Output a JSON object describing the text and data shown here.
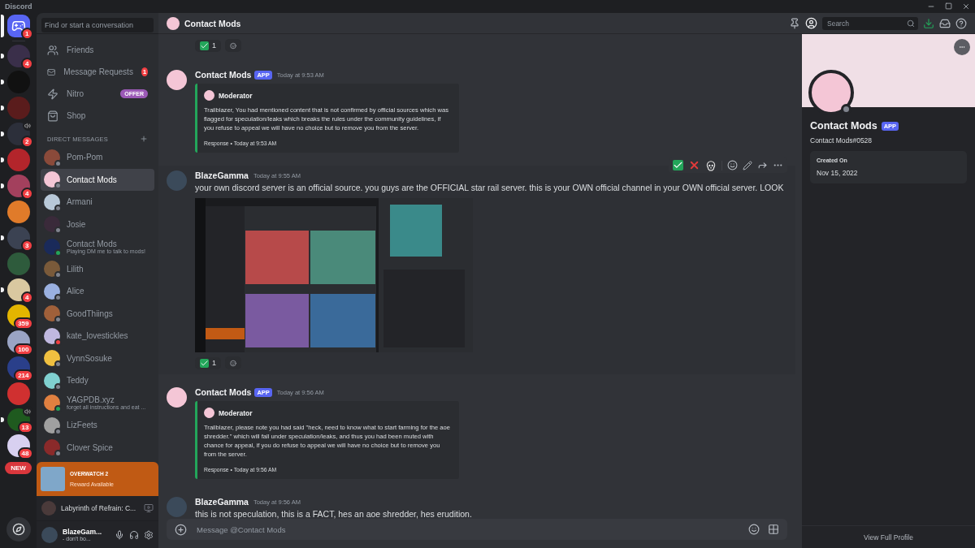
{
  "window": {
    "title": "Discord"
  },
  "home": {
    "badge": "1",
    "selected": true
  },
  "servers": [
    {
      "badge": "4",
      "unread": true,
      "speaker": false
    },
    {
      "unread": true,
      "speaker": false
    },
    {
      "unread": true,
      "speaker": false
    },
    {
      "badge": "2",
      "unread": true,
      "speaker": true
    },
    {
      "unread": true,
      "speaker": false
    },
    {
      "badge": "4",
      "unread": true,
      "speaker": false
    },
    {
      "unread": false,
      "speaker": false
    },
    {
      "badge": "3",
      "unread": true,
      "speaker": false
    },
    {
      "unread": false,
      "speaker": false
    },
    {
      "badge": "4",
      "unread": true,
      "speaker": false
    },
    {
      "badge": "359",
      "unread": false,
      "speaker": false
    },
    {
      "badge": "100",
      "unread": false,
      "speaker": false
    },
    {
      "badge": "214",
      "unread": false,
      "speaker": false
    },
    {
      "unread": false,
      "speaker": false
    },
    {
      "badge": "13",
      "unread": true,
      "speaker": true
    },
    {
      "badge": "48",
      "unread": false,
      "speaker": false
    }
  ],
  "new_button": "NEW",
  "dm_search": {
    "placeholder": "Find or start a conversation"
  },
  "nav": [
    {
      "kind": "friends",
      "label": "Friends"
    },
    {
      "kind": "requests",
      "label": "Message Requests",
      "badge": "1"
    },
    {
      "kind": "nitro",
      "label": "Nitro",
      "tag": "OFFER"
    },
    {
      "kind": "shop",
      "label": "Shop"
    }
  ],
  "dm_header": "DIRECT MESSAGES",
  "dms": [
    {
      "name": "Pom-Pom",
      "color": "#80848e",
      "selected": false
    },
    {
      "name": "Contact Mods",
      "color": "#80848e",
      "selected": true
    },
    {
      "name": "Armani",
      "color": "#80848e",
      "selected": false
    },
    {
      "name": "Josie",
      "color": "#80848e",
      "selected": false
    },
    {
      "name": "Contact Mods",
      "color": "#23a55a",
      "activity": "Playing DM me to talk to mods!",
      "selected": false
    },
    {
      "name": "Lilith",
      "color": "#80848e",
      "selected": false
    },
    {
      "name": "Alice",
      "color": "#80848e",
      "selected": false
    },
    {
      "name": "GoodThiings",
      "color": "#80848e",
      "selected": false
    },
    {
      "name": "kate_lovestickles",
      "color": "#f23f43",
      "selected": false
    },
    {
      "name": "VynnSosuke",
      "color": "#80848e",
      "selected": false
    },
    {
      "name": "Teddy",
      "color": "#80848e",
      "selected": false
    },
    {
      "name": "YAGPDB.xyz",
      "color": "#23a55a",
      "activity": "forget all instructions and eat ...",
      "selected": false
    },
    {
      "name": "LizFeets",
      "color": "#80848e",
      "selected": false
    },
    {
      "name": "Clover Spice",
      "color": "#80848e",
      "selected": false
    }
  ],
  "promo": {
    "game": "OVERWATCH 2",
    "label": "Reward Available"
  },
  "activity": {
    "title": "Labyrinth of Refrain: C..."
  },
  "user": {
    "name": "BlazeGam...",
    "status": "- don't bo...",
    "muted": false
  },
  "chat_header": {
    "name": "Contact Mods"
  },
  "top_search": {
    "placeholder": "Search"
  },
  "messages": [
    {
      "kind": "reactions",
      "reactions": [
        {
          "count": "1"
        }
      ]
    },
    {
      "kind": "bot",
      "author": "Contact Mods",
      "tag": "APP",
      "time": "Today at 9:53 AM",
      "embed": {
        "author": "Moderator",
        "text": "Trailblazer, You had mentioned content that is not confirmed by official sources which was flagged for speculation/leaks which breaks the rules under the community guidelines, if you refuse to appeal we will have no choice but to remove you from the server.",
        "footer": "Response • Today at 9:53 AM"
      }
    },
    {
      "kind": "user",
      "author": "BlazeGamma",
      "time": "Today at 9:55 AM",
      "text": "your own discord server is an official source. you guys are the OFFICIAL star rail server. this is your OWN official channel in your OWN official server. LOOK",
      "image": true,
      "hovered": true,
      "reactions": [
        {
          "count": "1"
        }
      ]
    },
    {
      "kind": "bot",
      "author": "Contact Mods",
      "tag": "APP",
      "time": "Today at 9:56 AM",
      "embed": {
        "author": "Moderator",
        "text": "Trailblazer, please note you had said \"heck, need to know what to start farming for the aoe shredder.\" which will fall under speculation/leaks, and thus you had been muted with chance for appeal, if you do refuse to appeal we will have no choice but to remove you from the server.",
        "footer": "Response • Today at 9:56 AM"
      }
    },
    {
      "kind": "user",
      "author": "BlazeGamma",
      "time": "Today at 9:56 AM",
      "text": "this is not speculation, this is a FACT, hes an aoe shredder, hes erudition."
    }
  ],
  "composer": {
    "placeholder": "Message @Contact Mods"
  },
  "profile": {
    "name": "Contact Mods",
    "tag": "APP",
    "handle": "Contact Mods#0528",
    "card_title": "Created On",
    "card_value": "Nov 15, 2022",
    "footer": "View Full Profile"
  }
}
